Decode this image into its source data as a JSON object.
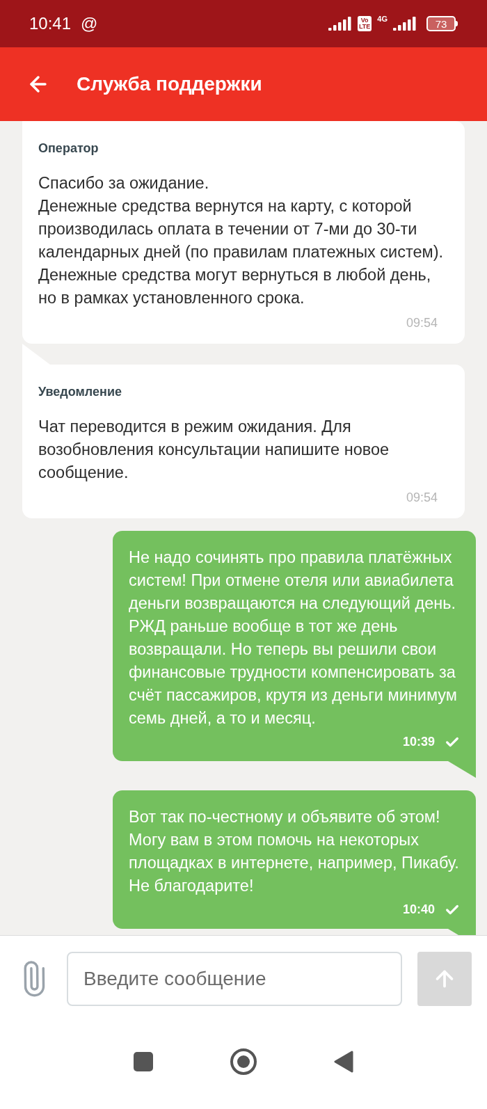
{
  "status_bar": {
    "time": "10:41",
    "at_sign": "@",
    "volte_top": "Vo",
    "volte_bottom": "LTE",
    "network": "4G",
    "battery": "73"
  },
  "header": {
    "title": "Служба поддержки"
  },
  "messages": [
    {
      "kind": "incoming",
      "sender": "Оператор",
      "text": "Спасибо за ожидание.\nДенежные средства вернутся на карту, с которой производилась оплата в течении от 7-ми до 30-ти календарных дней (по правилам платежных систем). Денежные средства могут вернуться в любой день, но в рамках установленного срока.",
      "time": "09:54"
    },
    {
      "kind": "incoming",
      "sender": "Уведомление",
      "text": "Чат переводится в режим ожидания. Для возобновления консультации напишите новое сообщение.",
      "time": "09:54"
    },
    {
      "kind": "outgoing",
      "text": "Не надо сочинять про правила платёжных систем! При отмене отеля или авиабилета деньги возвращаются на следующий день. РЖД раньше вообще в тот же день возвращали. Но теперь вы решили свои финансовые трудности компенсировать за счёт пассажиров, крутя из деньги минимум семь дней, а то и месяц.",
      "time": "10:39",
      "read": true
    },
    {
      "kind": "outgoing",
      "text": "Вот так по-честному и объявите об этом! Могу вам в этом помочь на некоторых площадках в интернете, например, Пикабу. Не благодарите!",
      "time": "10:40",
      "read": true
    }
  ],
  "composer": {
    "placeholder": "Введите сообщение",
    "send_disabled": true
  }
}
